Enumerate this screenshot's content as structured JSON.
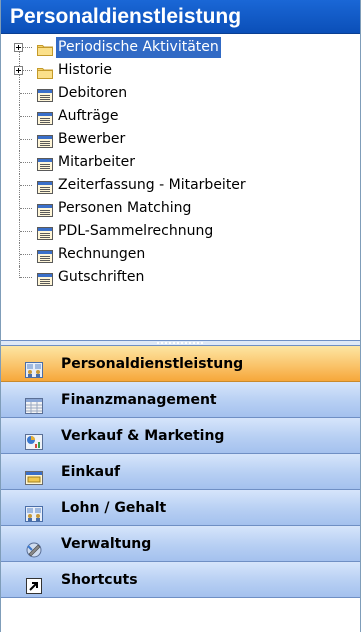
{
  "header": {
    "title": "Personaldienstleistung"
  },
  "tree": {
    "items": [
      {
        "label": "Periodische Aktivitäten",
        "kind": "folder",
        "expandable": true,
        "selected": true
      },
      {
        "label": "Historie",
        "kind": "folder",
        "expandable": true,
        "selected": false
      },
      {
        "label": "Debitoren",
        "kind": "list",
        "expandable": false,
        "selected": false
      },
      {
        "label": "Aufträge",
        "kind": "list",
        "expandable": false,
        "selected": false
      },
      {
        "label": "Bewerber",
        "kind": "list",
        "expandable": false,
        "selected": false
      },
      {
        "label": "Mitarbeiter",
        "kind": "list",
        "expandable": false,
        "selected": false
      },
      {
        "label": "Zeiterfassung - Mitarbeiter",
        "kind": "list",
        "expandable": false,
        "selected": false
      },
      {
        "label": "Personen Matching",
        "kind": "list",
        "expandable": false,
        "selected": false
      },
      {
        "label": "PDL-Sammelrechnung",
        "kind": "list",
        "expandable": false,
        "selected": false
      },
      {
        "label": "Rechnungen",
        "kind": "list",
        "expandable": false,
        "selected": false
      },
      {
        "label": "Gutschriften",
        "kind": "list",
        "expandable": false,
        "selected": false
      }
    ]
  },
  "nav": {
    "buttons": [
      {
        "label": "Personaldienstleistung",
        "icon": "people-grid-icon",
        "active": true
      },
      {
        "label": "Finanzmanagement",
        "icon": "ledger-grid-icon",
        "active": false
      },
      {
        "label": "Verkauf & Marketing",
        "icon": "chart-pie-icon",
        "active": false
      },
      {
        "label": "Einkauf",
        "icon": "shopping-window-icon",
        "active": false
      },
      {
        "label": "Lohn / Gehalt",
        "icon": "people-grid-icon",
        "active": false
      },
      {
        "label": "Verwaltung",
        "icon": "wrench-tools-icon",
        "active": false
      },
      {
        "label": "Shortcuts",
        "icon": "shortcut-arrow-icon",
        "active": false
      }
    ]
  },
  "colors": {
    "header_bg": "#0b4fb8",
    "selection": "#316ac5",
    "nav_bg": "#b7cff3",
    "nav_active_bg": "#fac46b"
  }
}
